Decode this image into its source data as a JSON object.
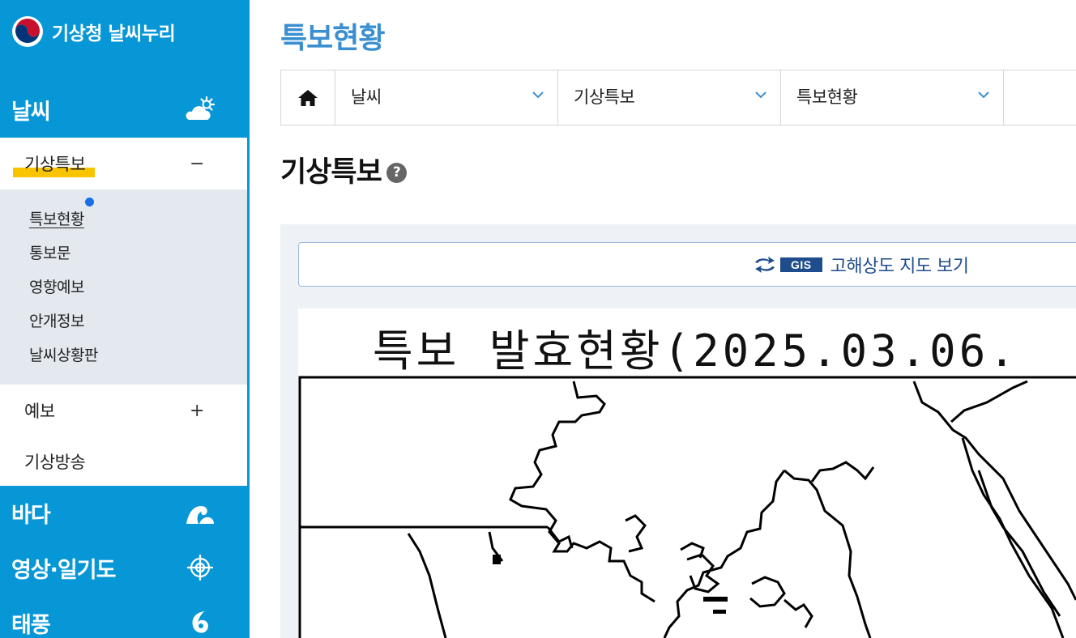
{
  "brand": {
    "name": "기상청 날씨누리"
  },
  "sidebar": {
    "weather": {
      "label": "날씨",
      "icon": "sun-cloud-icon"
    },
    "sub": [
      {
        "label": "기상특보",
        "toggle": "−",
        "expanded": true
      },
      {
        "label": "예보",
        "toggle": "+"
      },
      {
        "label": "기상방송"
      }
    ],
    "leaves": [
      {
        "label": "특보현황",
        "active": true
      },
      {
        "label": "통보문"
      },
      {
        "label": "영향예보"
      },
      {
        "label": "안개정보"
      },
      {
        "label": "날씨상황판"
      }
    ],
    "sea": {
      "label": "바다",
      "icon": "wave-icon"
    },
    "satellite": {
      "label": "영상·일기도",
      "icon": "target-icon"
    },
    "typhoon": {
      "label": "태풍",
      "icon": "typhoon-icon"
    }
  },
  "page": {
    "title": "특보현황"
  },
  "breadcrumb": {
    "home_icon": "home-icon",
    "items": [
      "날씨",
      "기상특보",
      "특보현황"
    ]
  },
  "section": {
    "title": "기상특보",
    "help": "?"
  },
  "gis": {
    "badge": "GIS",
    "label": "고해상도 지도 보기"
  },
  "map": {
    "title": "특보 발효현황(2025.03.06."
  },
  "colors": {
    "sidebar": "#0897d6",
    "highlight": "#f8c400",
    "title": "#3b8fd0",
    "gis": "#1f4c8c"
  }
}
